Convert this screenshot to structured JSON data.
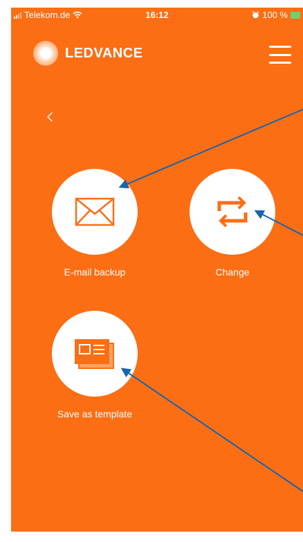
{
  "status_bar": {
    "carrier": "Telekom.de",
    "time": "16:12",
    "battery": "100 %"
  },
  "header": {
    "brand": "LEDVANCE"
  },
  "actions": [
    {
      "label": "E-mail backup",
      "icon": "envelope-icon"
    },
    {
      "label": "Change",
      "icon": "swap-arrows-icon"
    },
    {
      "label": "Save as template",
      "icon": "template-icon"
    }
  ],
  "colors": {
    "background": "#fb6e14",
    "icon": "#fb6e14",
    "annotation_arrow": "#1565b0"
  }
}
